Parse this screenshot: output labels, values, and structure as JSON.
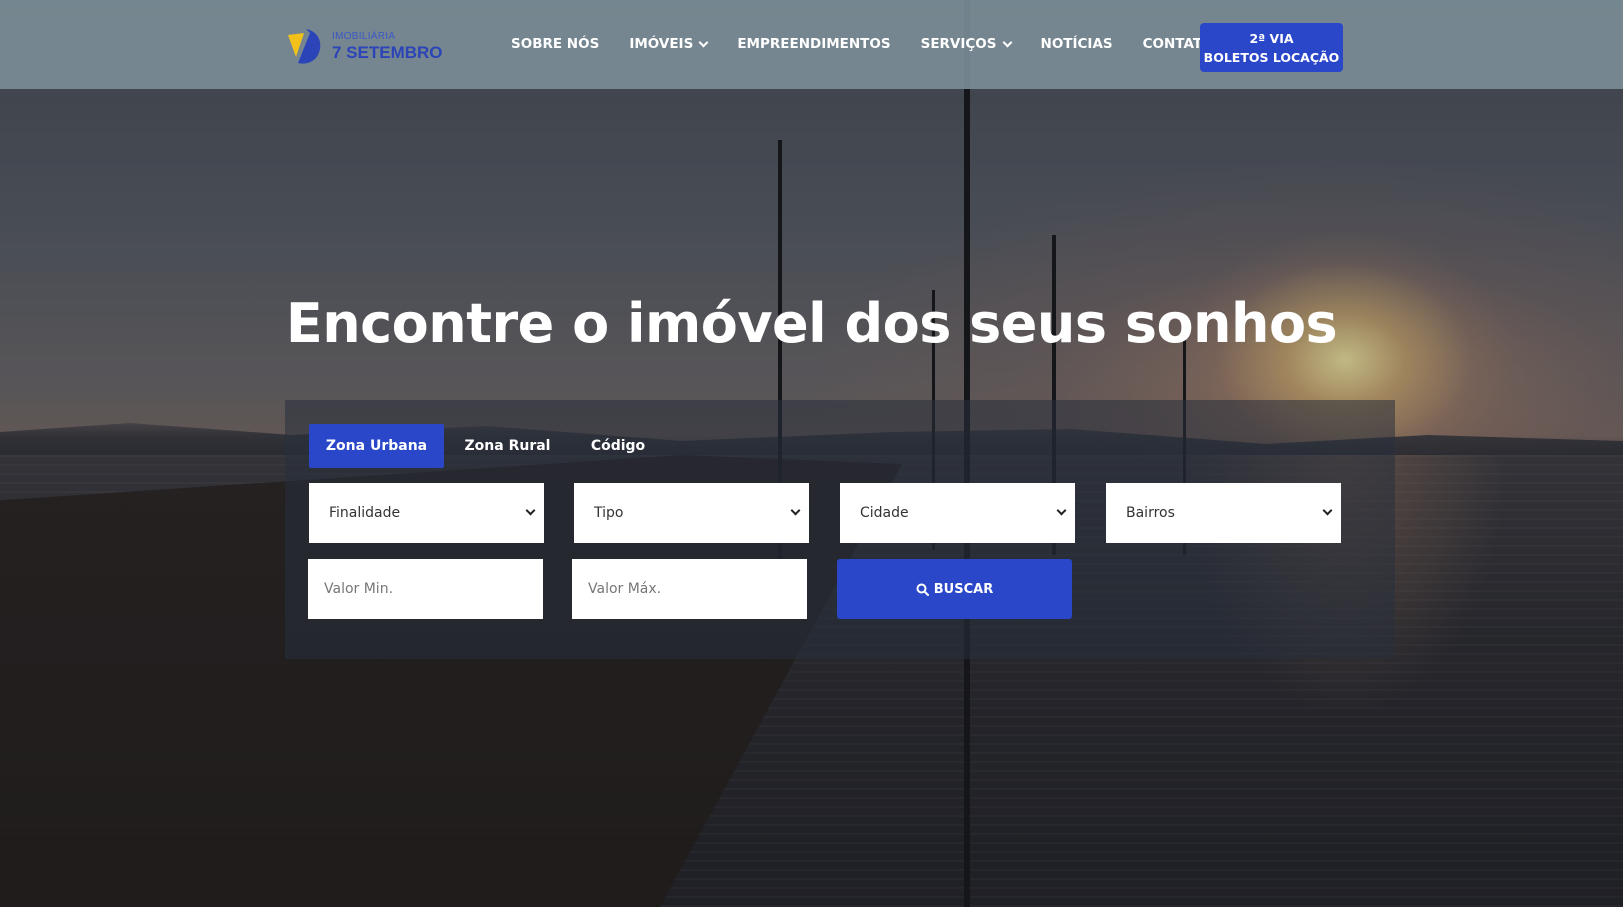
{
  "header": {
    "logo": {
      "small_text": "IMOBILIÁRIA",
      "big_text": "7 SETEMBRO",
      "icon": "logo-mark-icon"
    },
    "nav": [
      {
        "label": "SOBRE NÓS",
        "has_dropdown": false
      },
      {
        "label": "IMÓVEIS",
        "has_dropdown": true
      },
      {
        "label": "EMPREENDIMENTOS",
        "has_dropdown": false
      },
      {
        "label": "SERVIÇOS",
        "has_dropdown": true
      },
      {
        "label": "NOTÍCIAS",
        "has_dropdown": false
      },
      {
        "label": "CONTATOS",
        "has_dropdown": false
      }
    ],
    "cta": {
      "line1": "2ª VIA",
      "line2": "BOLETOS LOCAÇÃO"
    }
  },
  "hero": {
    "headline": "Encontre o imóvel dos seus sonhos"
  },
  "search": {
    "tabs": [
      {
        "label": "Zona Urbana",
        "active": true
      },
      {
        "label": "Zona Rural",
        "active": false
      },
      {
        "label": "Código",
        "active": false
      }
    ],
    "selects": {
      "finalidade": "Finalidade",
      "tipo": "Tipo",
      "cidade": "Cidade",
      "bairros": "Bairros"
    },
    "inputs": {
      "valor_min_placeholder": "Valor Min.",
      "valor_max_placeholder": "Valor Máx."
    },
    "submit_label": "BUSCAR"
  },
  "colors": {
    "accent": "#2a47c9",
    "header_bg": "#7a8c96",
    "logo_blue": "#2b45b8",
    "logo_yellow": "#f2c21b"
  }
}
